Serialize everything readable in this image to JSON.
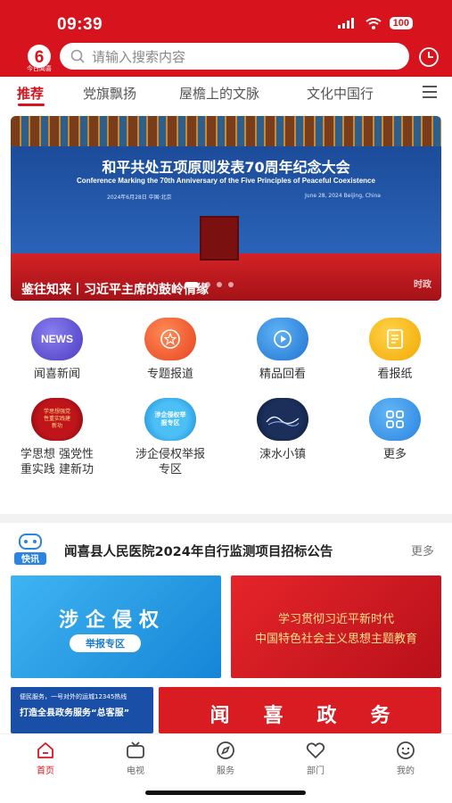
{
  "status": {
    "time": "09:39",
    "battery": "100"
  },
  "header": {
    "logo_text": "今日闻喜",
    "search_placeholder": "请输入搜索内容"
  },
  "tabs": [
    {
      "label": "推荐"
    },
    {
      "label": "党旗飘扬"
    },
    {
      "label": "屋檐上的文脉"
    },
    {
      "label": "文化中国行"
    }
  ],
  "banner": {
    "title": "和平共处五项原则发表70周年纪念大会",
    "subtitle": "Conference Marking the 70th Anniversary of the Five Principles of Peaceful Coexistence",
    "date_cn": "2024年6月28日 中国·北京",
    "date_en": "June 28, 2024  Beijing, China",
    "caption": "鉴往知来丨习近平主席的鼓岭情缘",
    "watermark": "时政"
  },
  "grid": [
    {
      "label": "闻喜新闻",
      "icon_text": "NEWS"
    },
    {
      "label": "专题报道"
    },
    {
      "label": "精品回看"
    },
    {
      "label": "看报纸"
    },
    {
      "label": "学思想 强党性 重实践 建新功",
      "icon_text": "学思想强党性重实践建新功"
    },
    {
      "label": "涉企侵权举报专区",
      "icon_text": "涉企侵权举报专区"
    },
    {
      "label": "涑水小镇"
    },
    {
      "label": "更多"
    }
  ],
  "kuaixun": {
    "logo_text": "快讯",
    "headline": "闻喜县人民医院2024年自行监测项目招标公告",
    "more": "更多"
  },
  "tiles": {
    "tile1_title": "涉企侵权",
    "tile1_sub": "举报专区",
    "tile2_line1": "学习贯彻习近平新时代",
    "tile2_line2": "中国特色社会主义思想主题教育",
    "tile3_line1": "便民服务，一号对外的运城12345热线",
    "tile3_line2": "打造全县政务服务“总客服”",
    "tile4_title": "闻喜政务"
  },
  "bottom_nav": [
    {
      "label": "首页"
    },
    {
      "label": "电视"
    },
    {
      "label": "服务"
    },
    {
      "label": "部门"
    },
    {
      "label": "我的"
    }
  ],
  "colors": {
    "brand_red": "#d7141d",
    "news_purple": "#5a4ec9",
    "accent_orange": "#f0562a",
    "accent_blue": "#2b8fe0",
    "accent_yellow": "#f5b800"
  }
}
